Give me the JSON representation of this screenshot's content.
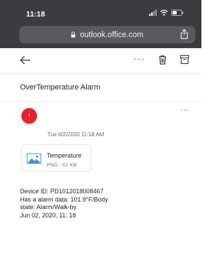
{
  "status": {
    "time": "11:18"
  },
  "browser": {
    "url": "outlook.office.com"
  },
  "email": {
    "subject": "OverTemperature Alarm",
    "avatar_initial": "!",
    "date": "Tue 6/2/2020 11:18 AM",
    "attachment": {
      "name": "Temperature",
      "meta": "PNG - 61 KB"
    },
    "body_lines": [
      "Device ID: PD1012018008467",
      "Has a alarm data: 101.9°F/Body",
      "state:  Alarm/Walk-by",
      "Jun 02, 2020, 11: 18"
    ]
  },
  "icons": {
    "more": "···",
    "colors": {
      "chrome": "#3c3c3e",
      "url_bar": "#5a5a5e",
      "avatar": "#e3262a"
    }
  }
}
